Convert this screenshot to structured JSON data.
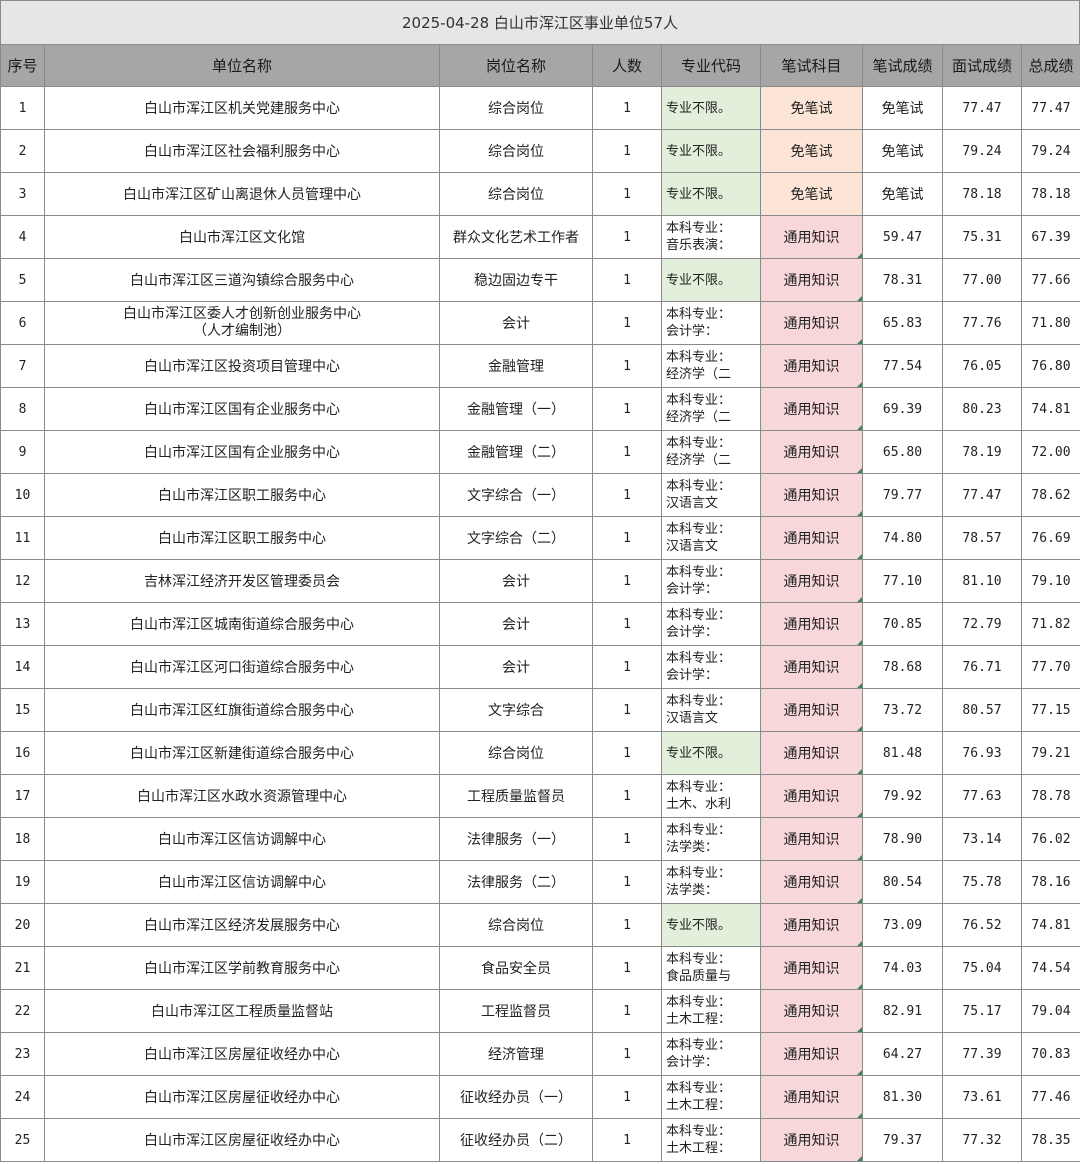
{
  "title": "2025-04-28   白山市浑江区事业单位57人",
  "headers": [
    "序号",
    "单位名称",
    "岗位名称",
    "人数",
    "专业代码",
    "笔试科目",
    "笔试成绩",
    "面试成绩",
    "总成绩"
  ],
  "rows": [
    {
      "no": "1",
      "unit": "白山市浑江区机关党建服务中心",
      "unit2": "",
      "post": "综合岗位",
      "count": "1",
      "major1": "专业不限。",
      "major2": "",
      "subject": "免笔试",
      "written": "免笔试",
      "interview": "77.47",
      "total": "77.47"
    },
    {
      "no": "2",
      "unit": "白山市浑江区社会福利服务中心",
      "unit2": "",
      "post": "综合岗位",
      "count": "1",
      "major1": "专业不限。",
      "major2": "",
      "subject": "免笔试",
      "written": "免笔试",
      "interview": "79.24",
      "total": "79.24"
    },
    {
      "no": "3",
      "unit": "白山市浑江区矿山离退休人员管理中心",
      "unit2": "",
      "post": "综合岗位",
      "count": "1",
      "major1": "专业不限。",
      "major2": "",
      "subject": "免笔试",
      "written": "免笔试",
      "interview": "78.18",
      "total": "78.18"
    },
    {
      "no": "4",
      "unit": "白山市浑江区文化馆",
      "unit2": "",
      "post": "群众文化艺术工作者",
      "count": "1",
      "major1": "本科专业：",
      "major2": "音乐表演：",
      "subject": "通用知识",
      "written": "59.47",
      "interview": "75.31",
      "total": "67.39"
    },
    {
      "no": "5",
      "unit": "白山市浑江区三道沟镇综合服务中心",
      "unit2": "",
      "post": "稳边固边专干",
      "count": "1",
      "major1": "专业不限。",
      "major2": "",
      "subject": "通用知识",
      "written": "78.31",
      "interview": "77.00",
      "total": "77.66"
    },
    {
      "no": "6",
      "unit": "白山市浑江区委人才创新创业服务中心",
      "unit2": "（人才编制池）",
      "post": "会计",
      "count": "1",
      "major1": "本科专业：",
      "major2": "会计学：",
      "subject": "通用知识",
      "written": "65.83",
      "interview": "77.76",
      "total": "71.80"
    },
    {
      "no": "7",
      "unit": "白山市浑江区投资项目管理中心",
      "unit2": "",
      "post": "金融管理",
      "count": "1",
      "major1": "本科专业：",
      "major2": "经济学（二",
      "subject": "通用知识",
      "written": "77.54",
      "interview": "76.05",
      "total": "76.80"
    },
    {
      "no": "8",
      "unit": "白山市浑江区国有企业服务中心",
      "unit2": "",
      "post": "金融管理（一）",
      "count": "1",
      "major1": "本科专业：",
      "major2": "经济学（二",
      "subject": "通用知识",
      "written": "69.39",
      "interview": "80.23",
      "total": "74.81"
    },
    {
      "no": "9",
      "unit": "白山市浑江区国有企业服务中心",
      "unit2": "",
      "post": "金融管理（二）",
      "count": "1",
      "major1": "本科专业：",
      "major2": "经济学（二",
      "subject": "通用知识",
      "written": "65.80",
      "interview": "78.19",
      "total": "72.00"
    },
    {
      "no": "10",
      "unit": "白山市浑江区职工服务中心",
      "unit2": "",
      "post": "文字综合（一）",
      "count": "1",
      "major1": "本科专业：",
      "major2": "汉语言文",
      "subject": "通用知识",
      "written": "79.77",
      "interview": "77.47",
      "total": "78.62"
    },
    {
      "no": "11",
      "unit": "白山市浑江区职工服务中心",
      "unit2": "",
      "post": "文字综合（二）",
      "count": "1",
      "major1": "本科专业：",
      "major2": "汉语言文",
      "subject": "通用知识",
      "written": "74.80",
      "interview": "78.57",
      "total": "76.69"
    },
    {
      "no": "12",
      "unit": "吉林浑江经济开发区管理委员会",
      "unit2": "",
      "post": "会计",
      "count": "1",
      "major1": "本科专业：",
      "major2": "会计学：",
      "subject": "通用知识",
      "written": "77.10",
      "interview": "81.10",
      "total": "79.10"
    },
    {
      "no": "13",
      "unit": "白山市浑江区城南街道综合服务中心",
      "unit2": "",
      "post": "会计",
      "count": "1",
      "major1": "本科专业：",
      "major2": "会计学：",
      "subject": "通用知识",
      "written": "70.85",
      "interview": "72.79",
      "total": "71.82"
    },
    {
      "no": "14",
      "unit": "白山市浑江区河口街道综合服务中心",
      "unit2": "",
      "post": "会计",
      "count": "1",
      "major1": "本科专业：",
      "major2": "会计学：",
      "subject": "通用知识",
      "written": "78.68",
      "interview": "76.71",
      "total": "77.70"
    },
    {
      "no": "15",
      "unit": "白山市浑江区红旗街道综合服务中心",
      "unit2": "",
      "post": "文字综合",
      "count": "1",
      "major1": "本科专业：",
      "major2": "汉语言文",
      "subject": "通用知识",
      "written": "73.72",
      "interview": "80.57",
      "total": "77.15"
    },
    {
      "no": "16",
      "unit": "白山市浑江区新建街道综合服务中心",
      "unit2": "",
      "post": "综合岗位",
      "count": "1",
      "major1": "专业不限。",
      "major2": "",
      "subject": "通用知识",
      "written": "81.48",
      "interview": "76.93",
      "total": "79.21"
    },
    {
      "no": "17",
      "unit": "白山市浑江区水政水资源管理中心",
      "unit2": "",
      "post": "工程质量监督员",
      "count": "1",
      "major1": "本科专业：",
      "major2": "土木、水利",
      "subject": "通用知识",
      "written": "79.92",
      "interview": "77.63",
      "total": "78.78"
    },
    {
      "no": "18",
      "unit": "白山市浑江区信访调解中心",
      "unit2": "",
      "post": "法律服务（一）",
      "count": "1",
      "major1": "本科专业：",
      "major2": "法学类：",
      "subject": "通用知识",
      "written": "78.90",
      "interview": "73.14",
      "total": "76.02"
    },
    {
      "no": "19",
      "unit": "白山市浑江区信访调解中心",
      "unit2": "",
      "post": "法律服务（二）",
      "count": "1",
      "major1": "本科专业：",
      "major2": "法学类：",
      "subject": "通用知识",
      "written": "80.54",
      "interview": "75.78",
      "total": "78.16"
    },
    {
      "no": "20",
      "unit": "白山市浑江区经济发展服务中心",
      "unit2": "",
      "post": "综合岗位",
      "count": "1",
      "major1": "专业不限。",
      "major2": "",
      "subject": "通用知识",
      "written": "73.09",
      "interview": "76.52",
      "total": "74.81"
    },
    {
      "no": "21",
      "unit": "白山市浑江区学前教育服务中心",
      "unit2": "",
      "post": "食品安全员",
      "count": "1",
      "major1": "本科专业：",
      "major2": "食品质量与",
      "subject": "通用知识",
      "written": "74.03",
      "interview": "75.04",
      "total": "74.54"
    },
    {
      "no": "22",
      "unit": "白山市浑江区工程质量监督站",
      "unit2": "",
      "post": "工程监督员",
      "count": "1",
      "major1": "本科专业：",
      "major2": "土木工程：",
      "subject": "通用知识",
      "written": "82.91",
      "interview": "75.17",
      "total": "79.04"
    },
    {
      "no": "23",
      "unit": "白山市浑江区房屋征收经办中心",
      "unit2": "",
      "post": "经济管理",
      "count": "1",
      "major1": "本科专业：",
      "major2": "会计学：",
      "subject": "通用知识",
      "written": "64.27",
      "interview": "77.39",
      "total": "70.83"
    },
    {
      "no": "24",
      "unit": "白山市浑江区房屋征收经办中心",
      "unit2": "",
      "post": "征收经办员（一）",
      "count": "1",
      "major1": "本科专业：",
      "major2": "土木工程：",
      "subject": "通用知识",
      "written": "81.30",
      "interview": "73.61",
      "total": "77.46"
    },
    {
      "no": "25",
      "unit": "白山市浑江区房屋征收经办中心",
      "unit2": "",
      "post": "征收经办员（二）",
      "count": "1",
      "major1": "本科专业：",
      "major2": "土木工程：",
      "subject": "通用知识",
      "written": "79.37",
      "interview": "77.32",
      "total": "78.35"
    }
  ],
  "colors": {
    "header_bg": "#a6a6a6",
    "title_bg": "#e6e6e6",
    "unrestricted_bg": "#e2efda",
    "exempt_bg": "#fce4d6",
    "general_bg": "#f8d7da"
  }
}
